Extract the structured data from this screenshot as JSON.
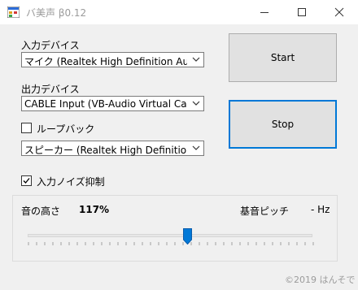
{
  "window": {
    "title": "バ美声 β0.12",
    "controls": [
      "minimize-icon",
      "maximize-icon",
      "close-icon"
    ]
  },
  "input_device": {
    "label": "入力デバイス",
    "value": "マイク (Realtek High Definition Au"
  },
  "output_device": {
    "label": "出力デバイス",
    "value": "CABLE Input (VB-Audio Virtual Cable)"
  },
  "loopback": {
    "label": "ループバック",
    "checked": false,
    "device_value": "スピーカー (Realtek High Definition Audio"
  },
  "noise_suppression": {
    "label": "入力ノイズ抑制",
    "checked": true
  },
  "buttons": {
    "start_label": "Start",
    "stop_label": "Stop"
  },
  "pitch": {
    "label": "音の高さ",
    "value_text": "117%",
    "base_pitch_label": "基音ピッチ",
    "base_pitch_value": "-  Hz",
    "slider_fraction": 0.56
  },
  "footer": {
    "copyright": "©2019  はんそで"
  },
  "colors": {
    "focus_accent": "#0078d7",
    "thumb": "#0078d7",
    "window_bg": "#f0f0f0"
  }
}
